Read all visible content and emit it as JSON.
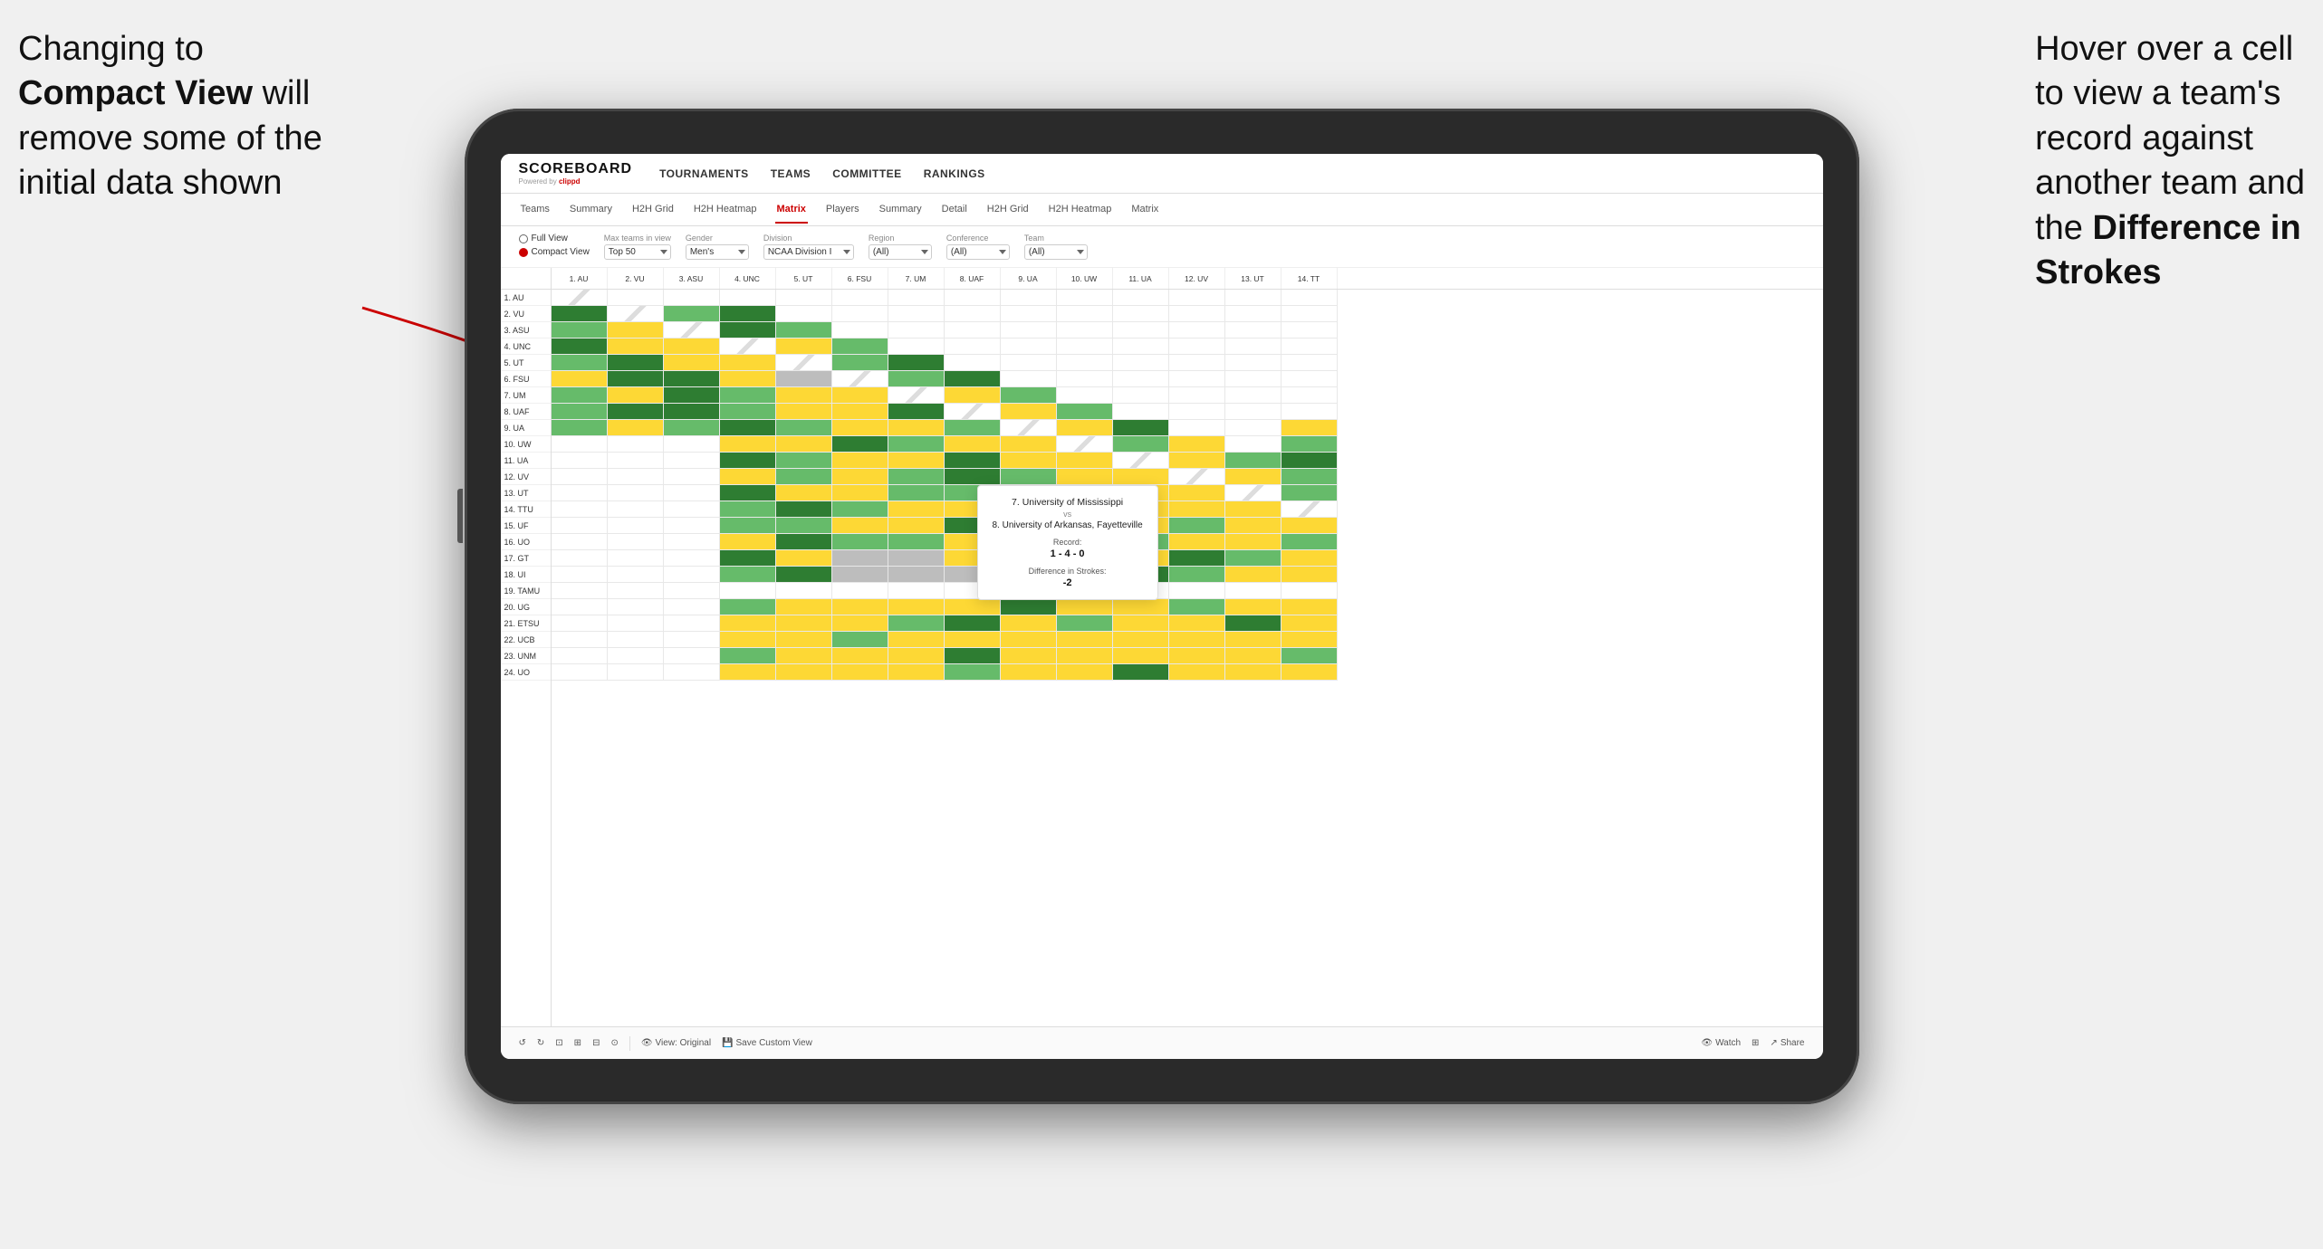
{
  "annotations": {
    "left": {
      "line1": "Changing to",
      "line2": "Compact View will",
      "line3": "remove some of the",
      "line4": "initial data shown"
    },
    "right": {
      "line1": "Hover over a cell",
      "line2": "to view a team's",
      "line3": "record against",
      "line4": "another team and",
      "line5": "the ",
      "line5bold": "Difference in",
      "line6bold": "Strokes"
    }
  },
  "nav": {
    "logo": "SCOREBOARD",
    "logo_sub": "Powered by clippd",
    "items": [
      "TOURNAMENTS",
      "TEAMS",
      "COMMITTEE",
      "RANKINGS"
    ]
  },
  "sub_nav": {
    "items": [
      "Teams",
      "Summary",
      "H2H Grid",
      "H2H Heatmap",
      "Matrix",
      "Players",
      "Summary",
      "Detail",
      "H2H Grid",
      "H2H Heatmap",
      "Matrix"
    ],
    "active": "Matrix"
  },
  "controls": {
    "view_full": "Full View",
    "view_compact": "Compact View",
    "selected_view": "compact",
    "filters": [
      {
        "label": "Max teams in view",
        "value": "Top 50"
      },
      {
        "label": "Gender",
        "value": "Men's"
      },
      {
        "label": "Division",
        "value": "NCAA Division I"
      },
      {
        "label": "Region",
        "value": "(All)"
      },
      {
        "label": "Conference",
        "value": "(All)"
      },
      {
        "label": "Team",
        "value": "(All)"
      }
    ]
  },
  "col_headers": [
    "1. AU",
    "2. VU",
    "3. ASU",
    "4. UNC",
    "5. UT",
    "6. FSU",
    "7. UM",
    "8. UAF",
    "9. UA",
    "10. UW",
    "11. UA",
    "12. UV",
    "13. UT",
    "14. TT"
  ],
  "row_labels": [
    "1. AU",
    "2. VU",
    "3. ASU",
    "4. UNC",
    "5. UT",
    "6. FSU",
    "7. UM",
    "8. UAF",
    "9. UA",
    "10. UW",
    "11. UA",
    "12. UV",
    "13. UT",
    "14. TTU",
    "15. UF",
    "16. UO",
    "17. GT",
    "18. UI",
    "19. TAMU",
    "20. UG",
    "21. ETSU",
    "22. UCB",
    "23. UNM",
    "24. UO"
  ],
  "tooltip": {
    "team1": "7. University of Mississippi",
    "vs": "vs",
    "team2": "8. University of Arkansas, Fayetteville",
    "record_label": "Record:",
    "record": "1 - 4 - 0",
    "diff_label": "Difference in Strokes:",
    "diff": "-2"
  },
  "toolbar": {
    "undo": "↺",
    "redo": "↻",
    "view_original": "View: Original",
    "save_custom": "Save Custom View",
    "watch": "Watch",
    "share": "Share"
  }
}
